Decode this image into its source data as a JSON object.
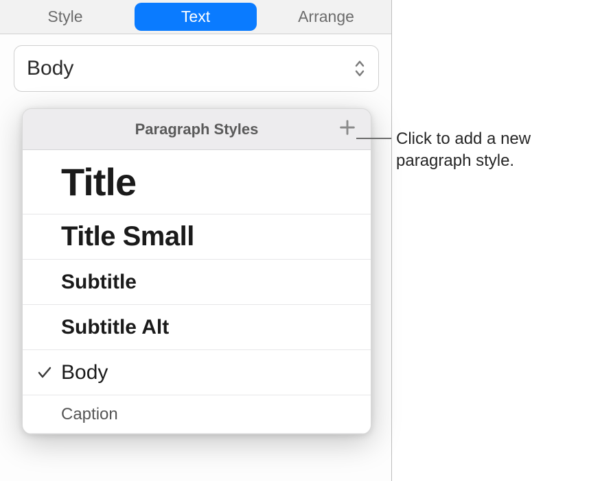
{
  "tabs": {
    "style": "Style",
    "text": "Text",
    "arrange": "Arrange"
  },
  "selector": {
    "value": "Body"
  },
  "popover": {
    "title": "Paragraph Styles",
    "items": [
      {
        "label": "Title",
        "class": "title-big-text",
        "row": "title-big",
        "selected": false
      },
      {
        "label": "Title Small",
        "class": "title-small-text",
        "row": "",
        "selected": false
      },
      {
        "label": "Subtitle",
        "class": "subtitle-text",
        "row": "",
        "selected": false
      },
      {
        "label": "Subtitle Alt",
        "class": "subtitle-alt-text",
        "row": "",
        "selected": false
      },
      {
        "label": "Body",
        "class": "body-text",
        "row": "",
        "selected": true
      },
      {
        "label": "Caption",
        "class": "caption-text",
        "row": "caption-row",
        "selected": false
      }
    ]
  },
  "callout": {
    "line1": "Click to add a new",
    "line2": "paragraph style."
  }
}
